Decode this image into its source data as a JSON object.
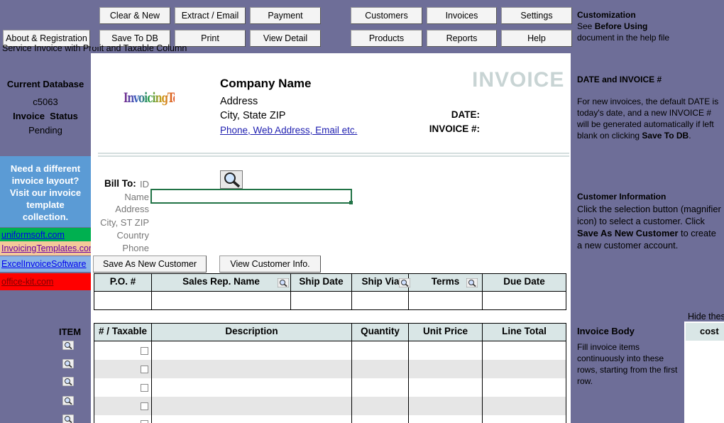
{
  "toolbar": {
    "about_label": "About & Registration",
    "clear_new": "Clear & New",
    "extract_email": "Extract / Email",
    "payment": "Payment",
    "save_db": "Save To DB",
    "print": "Print",
    "view_detail": "View Detail",
    "customers": "Customers",
    "invoices": "Invoices",
    "settings": "Settings",
    "products": "Products",
    "reports": "Reports",
    "help": "Help",
    "customization_title": "Customization",
    "customization_see": "See ",
    "customization_bold": "Before Using",
    "customization_rest": "document in the help file",
    "sheet_title": "Service Invoice with Profit and Taxable Column"
  },
  "left": {
    "current_db_label": "Current Database",
    "db_name": "c5063",
    "status_label": "Invoice  Status",
    "status_value": "Pending",
    "promo": "Need a different invoice layout? Visit our invoice template collection.",
    "links": [
      "uniformsoft.com",
      "InvoicingTemplates.com",
      "ExcelInvoiceSoftware",
      "office-kit.com"
    ],
    "item_label": "ITEM"
  },
  "invoice": {
    "logo_text": "InvoicingTemplates",
    "company_name": "Company Name",
    "address": "Address",
    "city_state": "City, State ZIP",
    "contact_link": "Phone, Web Address, Email etc.",
    "title": "INVOICE",
    "date_label": "DATE:",
    "invoice_no_label": "INVOICE #:",
    "bill_to": "Bill To:",
    "id_label": "ID",
    "name_label": "Name",
    "address_label": "Address",
    "city_label": "City, ST ZIP",
    "country_label": "Country",
    "phone_label": "Phone",
    "save_customer_btn": "Save As New Customer",
    "view_customer_btn": "View Customer Info."
  },
  "order_table": {
    "headers": [
      "P.O. #",
      "Sales Rep. Name",
      "Ship Date",
      "Ship Via",
      "Terms",
      "Due Date"
    ]
  },
  "items_table": {
    "headers": [
      "# / Taxable",
      "Description",
      "Quantity",
      "Unit Price",
      "Line Total"
    ]
  },
  "right": {
    "date_title": "DATE and INVOICE #",
    "date_text": "For new invoices, the default DATE is today's date, and a new INVOICE # will be generated automatically if left blank on clicking ",
    "date_bold": "Save To DB",
    "date_end": ".",
    "cust_title": "Customer Information",
    "cust_text1": "Click the selection button (magnifier icon) to select a customer. Click ",
    "cust_bold": "Save As New Customer",
    "cust_text2": " to create a new customer account.",
    "body_title": "Invoice Body",
    "body_text": "Fill invoice items continuously into these rows, starting from the first row.",
    "hide_label": "Hide thes",
    "cost_label": "cost"
  },
  "colors": {
    "panel": "#6e6e98",
    "promo_bg": "#5b9bd5",
    "link_green": "#00b050",
    "link_tan": "#f4c89a",
    "link_blue": "#8ab4e6",
    "link_red": "#ff0000",
    "title_gray": "#c8d4d4",
    "header_fill": "#d9e6e6"
  }
}
